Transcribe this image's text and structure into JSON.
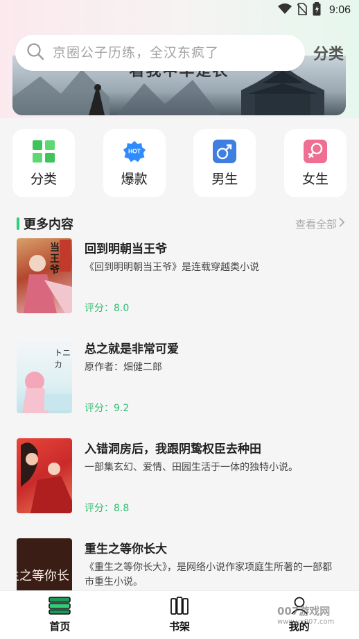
{
  "status_bar": {
    "time": "9:06"
  },
  "banner": {
    "title": "看我中华是农"
  },
  "search": {
    "placeholder": "京圈公子历练，全汉东疯了"
  },
  "header": {
    "category_label": "分类"
  },
  "quick_nav": [
    {
      "label": "分类",
      "icon": "grid-icon",
      "color": "#3ec45a"
    },
    {
      "label": "爆款",
      "icon": "hot-badge-icon",
      "color": "#2f8cff"
    },
    {
      "label": "男生",
      "icon": "male-icon",
      "color": "#3f7fe0"
    },
    {
      "label": "女生",
      "icon": "female-icon",
      "color": "#ef6f93"
    }
  ],
  "section": {
    "title": "更多内容",
    "see_all": "查看全部"
  },
  "books": [
    {
      "title": "回到明朝当王爷",
      "desc": "《回到明明朝当王爷》是连载穿越类小说",
      "score": "评分：8.0",
      "cover_text": "当王爷"
    },
    {
      "title": "总之就是非常可爱",
      "desc": "原作者：畑健二郎",
      "score": "评分：9.2",
      "cover_text": "トニカ"
    },
    {
      "title": "入错洞房后，我跟阴鸷权臣去种田",
      "desc": "一部集玄幻、爱情、田园生活于一体的独特小说。",
      "score": "评分：8.8",
      "cover_text": ""
    },
    {
      "title": "重生之等你长大",
      "desc": "《重生之等你长大》，是网络小说作家项庭生所著的一部都市重生小说。",
      "score": "",
      "cover_text": "生之等你长"
    }
  ],
  "bottom_nav": [
    {
      "label": "首页",
      "icon": "home-books-icon"
    },
    {
      "label": "书架",
      "icon": "bookshelf-icon"
    },
    {
      "label": "我的",
      "icon": "person-icon"
    }
  ],
  "watermark": {
    "text": "007游戏网",
    "url": "www.yx007.com"
  },
  "colors": {
    "accent": "#2fcf7a",
    "score": "#2fbf6f"
  }
}
